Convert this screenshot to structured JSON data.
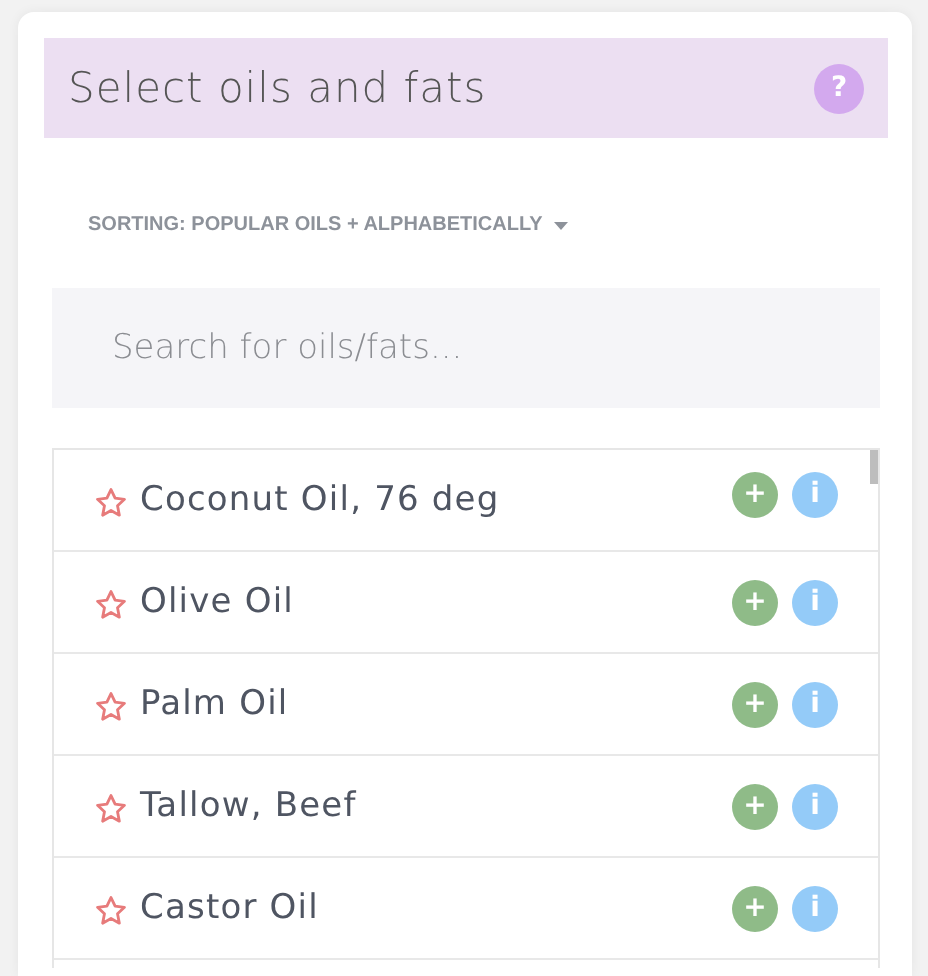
{
  "panel": {
    "title": "Select oils and fats",
    "help_icon": "?"
  },
  "sorting": {
    "label": "SORTING: POPULAR OILS + ALPHABETICALLY"
  },
  "search": {
    "placeholder": "Search for oils/fats..."
  },
  "oils": [
    {
      "name": "Coconut Oil, 76 deg",
      "favorite": false,
      "add_label": "+",
      "info_label": "i"
    },
    {
      "name": "Olive Oil",
      "favorite": false,
      "add_label": "+",
      "info_label": "i"
    },
    {
      "name": "Palm Oil",
      "favorite": false,
      "add_label": "+",
      "info_label": "i"
    },
    {
      "name": "Tallow, Beef",
      "favorite": false,
      "add_label": "+",
      "info_label": "i"
    },
    {
      "name": "Castor Oil",
      "favorite": false,
      "add_label": "+",
      "info_label": "i"
    }
  ]
}
